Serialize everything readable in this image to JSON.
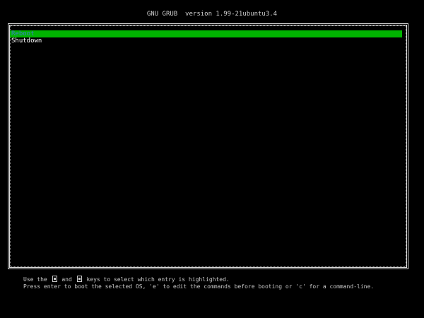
{
  "header": {
    "title": "GNU GRUB  version 1.99-21ubuntu3.4"
  },
  "menu": {
    "items": [
      {
        "label": "Reboot",
        "selected": true
      },
      {
        "label": "Shutdown",
        "selected": false
      }
    ]
  },
  "help": {
    "line1_prefix": "Use the ",
    "key_up": "up-arrow-key-icon",
    "line1_and": " and ",
    "key_down": "down-arrow-key-icon",
    "line1_suffix": " keys to select which entry is highlighted.",
    "line2": "Press enter to boot the selected OS, 'e' to edit the commands before booting or 'c' for a command-line."
  },
  "colors": {
    "background": "#000000",
    "highlight": "#00b400",
    "frame": "#dcdcdc"
  }
}
